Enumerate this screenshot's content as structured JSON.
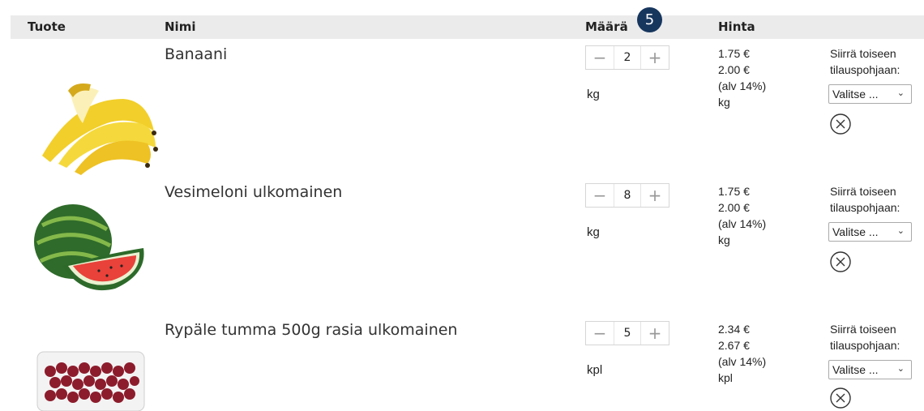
{
  "header": {
    "col_product": "Tuote",
    "col_name": "Nimi",
    "col_quantity": "Määrä",
    "col_price": "Hinta",
    "badge": "5"
  },
  "items": [
    {
      "name": "Banaani",
      "quantity": "2",
      "minus": "−",
      "plus": "+",
      "unit": "kg",
      "price_net": "1.75 €",
      "price_gross": "2.00 €",
      "vat": "(alv 14%)",
      "price_unit": "kg",
      "move_line1": "Siirrä toiseen",
      "move_line2": "tilauspohjaan:",
      "select_value": "Valitse ...",
      "icon": "banana-image"
    },
    {
      "name": "Vesimeloni ulkomainen",
      "quantity": "8",
      "minus": "−",
      "plus": "+",
      "unit": "kg",
      "price_net": "1.75 €",
      "price_gross": "2.00 €",
      "vat": "(alv 14%)",
      "price_unit": "kg",
      "move_line1": "Siirrä toiseen",
      "move_line2": "tilauspohjaan:",
      "select_value": "Valitse ...",
      "icon": "watermelon-image"
    },
    {
      "name": "Rypäle tumma 500g rasia ulkomainen",
      "quantity": "5",
      "minus": "−",
      "plus": "+",
      "unit": "kpl",
      "price_net": "2.34 €",
      "price_gross": "2.67 €",
      "vat": "(alv 14%)",
      "price_unit": "kpl",
      "move_line1": "Siirrä toiseen",
      "move_line2": "tilauspohjaan:",
      "select_value": "Valitse ...",
      "icon": "grapes-image"
    }
  ],
  "colors": {
    "header_bg": "#ebebeb",
    "badge_bg": "#17365e"
  }
}
